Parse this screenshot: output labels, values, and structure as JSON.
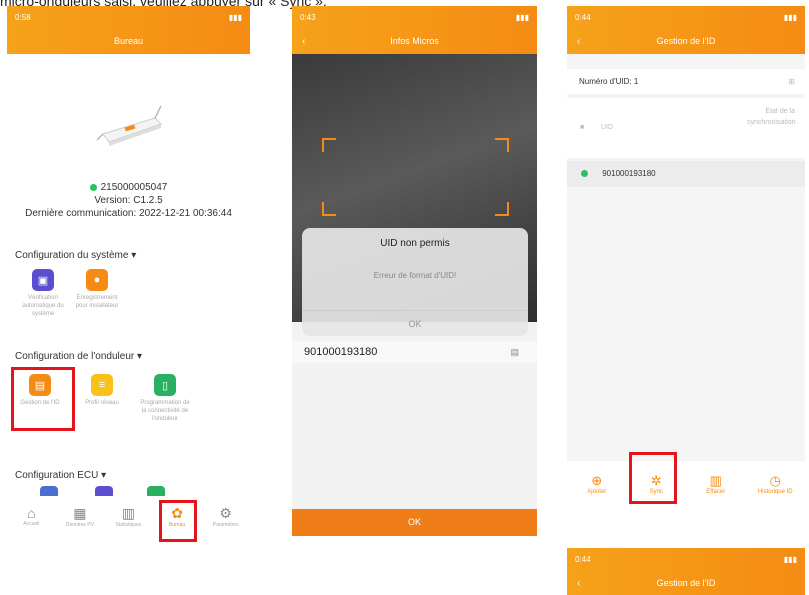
{
  "caption": "micro-onduleurs saisi, veuillez appuyer sur « Sync ».",
  "phone1": {
    "status_time": "0:58",
    "status_right": "",
    "title": "Bureau",
    "device_id": "215000005047",
    "version": "Version: C1.2.5",
    "last_comm": "Dernière communication: 2022-12-21 00:36:44",
    "sections": [
      "Configuration du système",
      "Configuration de l'onduleur",
      "Configuration ECU"
    ],
    "system_tiles": [
      {
        "label": "Vérification automatique du système",
        "color": "#5b4fcf"
      },
      {
        "label": "Enregistrement pour installateur",
        "color": "#f58b14"
      }
    ],
    "inverter_tiles": [
      {
        "label": "Gestion de l'ID",
        "color": "#f58b14"
      },
      {
        "label": "Profil réseau",
        "color": "#f8c21a"
      },
      {
        "label": "Programmation de la connectivité de l'onduleur",
        "color": "#2ab060"
      }
    ],
    "nav": [
      {
        "label": "Accueil",
        "icon": "home-icon"
      },
      {
        "label": "Données PV",
        "icon": "grid-icon"
      },
      {
        "label": "Statistiques",
        "icon": "bars-icon"
      },
      {
        "label": "Bureau",
        "icon": "workspace-icon"
      },
      {
        "label": "Paramètres",
        "icon": "gear-icon"
      }
    ]
  },
  "phone2": {
    "status_time": "0:43",
    "title": "Infos Micros",
    "dialog_title": "UID non permis",
    "dialog_msg": "Erreur de format d'UID!",
    "dialog_ok": "OK",
    "uid_value": "901000193180",
    "ok_label": "OK"
  },
  "phone3": {
    "status_time": "0:44",
    "title": "Gestion de l'ID",
    "uid_count": "Numéro d'UID: 1",
    "col_uid": "UID",
    "col_state": "État de la synchronisation",
    "uid_value": "901000193180",
    "tools": [
      {
        "label": "Ajouter",
        "icon": "plus-icon"
      },
      {
        "label": "Sync",
        "icon": "sync-icon"
      },
      {
        "label": "Effacer",
        "icon": "trash-icon"
      },
      {
        "label": "Historique ID",
        "icon": "clock-icon"
      }
    ]
  },
  "phone4": {
    "status_time": "0:44",
    "title": "Gestion de l'ID"
  },
  "colors": {
    "accent": "#f58b14",
    "highlight": "#e4141c",
    "online": "#2ac060"
  }
}
